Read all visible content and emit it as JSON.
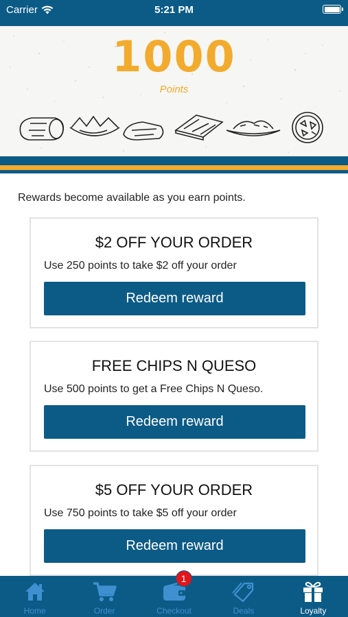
{
  "status_bar": {
    "carrier": "Carrier",
    "time": "5:21 PM"
  },
  "hero": {
    "points_value": "1000",
    "points_label": "Points"
  },
  "colors": {
    "brand_blue": "#0c5b86",
    "accent_gold": "#f2ab2d",
    "tab_inactive": "#3e90d0",
    "badge_red": "#e3141b"
  },
  "intro_text": "Rewards become available as you earn points.",
  "rewards": [
    {
      "title": "$2 OFF YOUR ORDER",
      "description": "Use 250 points to take $2 off your order",
      "button_label": "Redeem reward"
    },
    {
      "title": "FREE CHIPS N QUESO",
      "description": "Use 500 points to get a Free Chips N Queso.",
      "button_label": "Redeem reward"
    },
    {
      "title": "$5 OFF YOUR ORDER",
      "description": "Use 750 points to take $5 off your order",
      "button_label": "Redeem reward"
    }
  ],
  "tabs": [
    {
      "label": "Home",
      "icon": "home-icon"
    },
    {
      "label": "Order",
      "icon": "cart-icon"
    },
    {
      "label": "Checkout",
      "icon": "wallet-icon",
      "badge": "1"
    },
    {
      "label": "Deals",
      "icon": "tag-icon"
    },
    {
      "label": "Loyalty",
      "icon": "gift-icon",
      "active": true
    }
  ]
}
